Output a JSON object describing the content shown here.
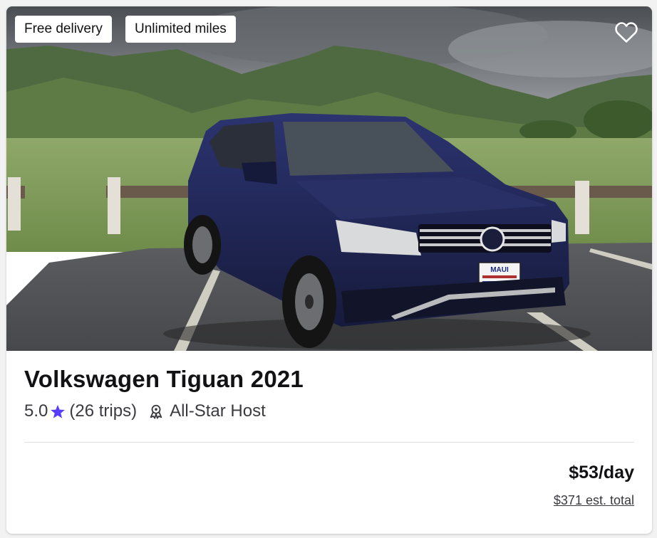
{
  "listing": {
    "badges": [
      "Free delivery",
      "Unlimited miles"
    ],
    "title": "Volkswagen Tiguan 2021",
    "rating": "5.0",
    "trips": "(26 trips)",
    "host_label": "All-Star Host",
    "price_per_day": "$53/day",
    "estimated_total": "$371 est. total"
  },
  "plate_text": "MAUI",
  "icons": {
    "favorite": "heart-outline-icon",
    "rating": "star-icon",
    "host": "award-ribbon-icon"
  },
  "colors": {
    "accent_star": "#593cfb",
    "car_body": "#1f2450",
    "text_primary": "#121214"
  }
}
